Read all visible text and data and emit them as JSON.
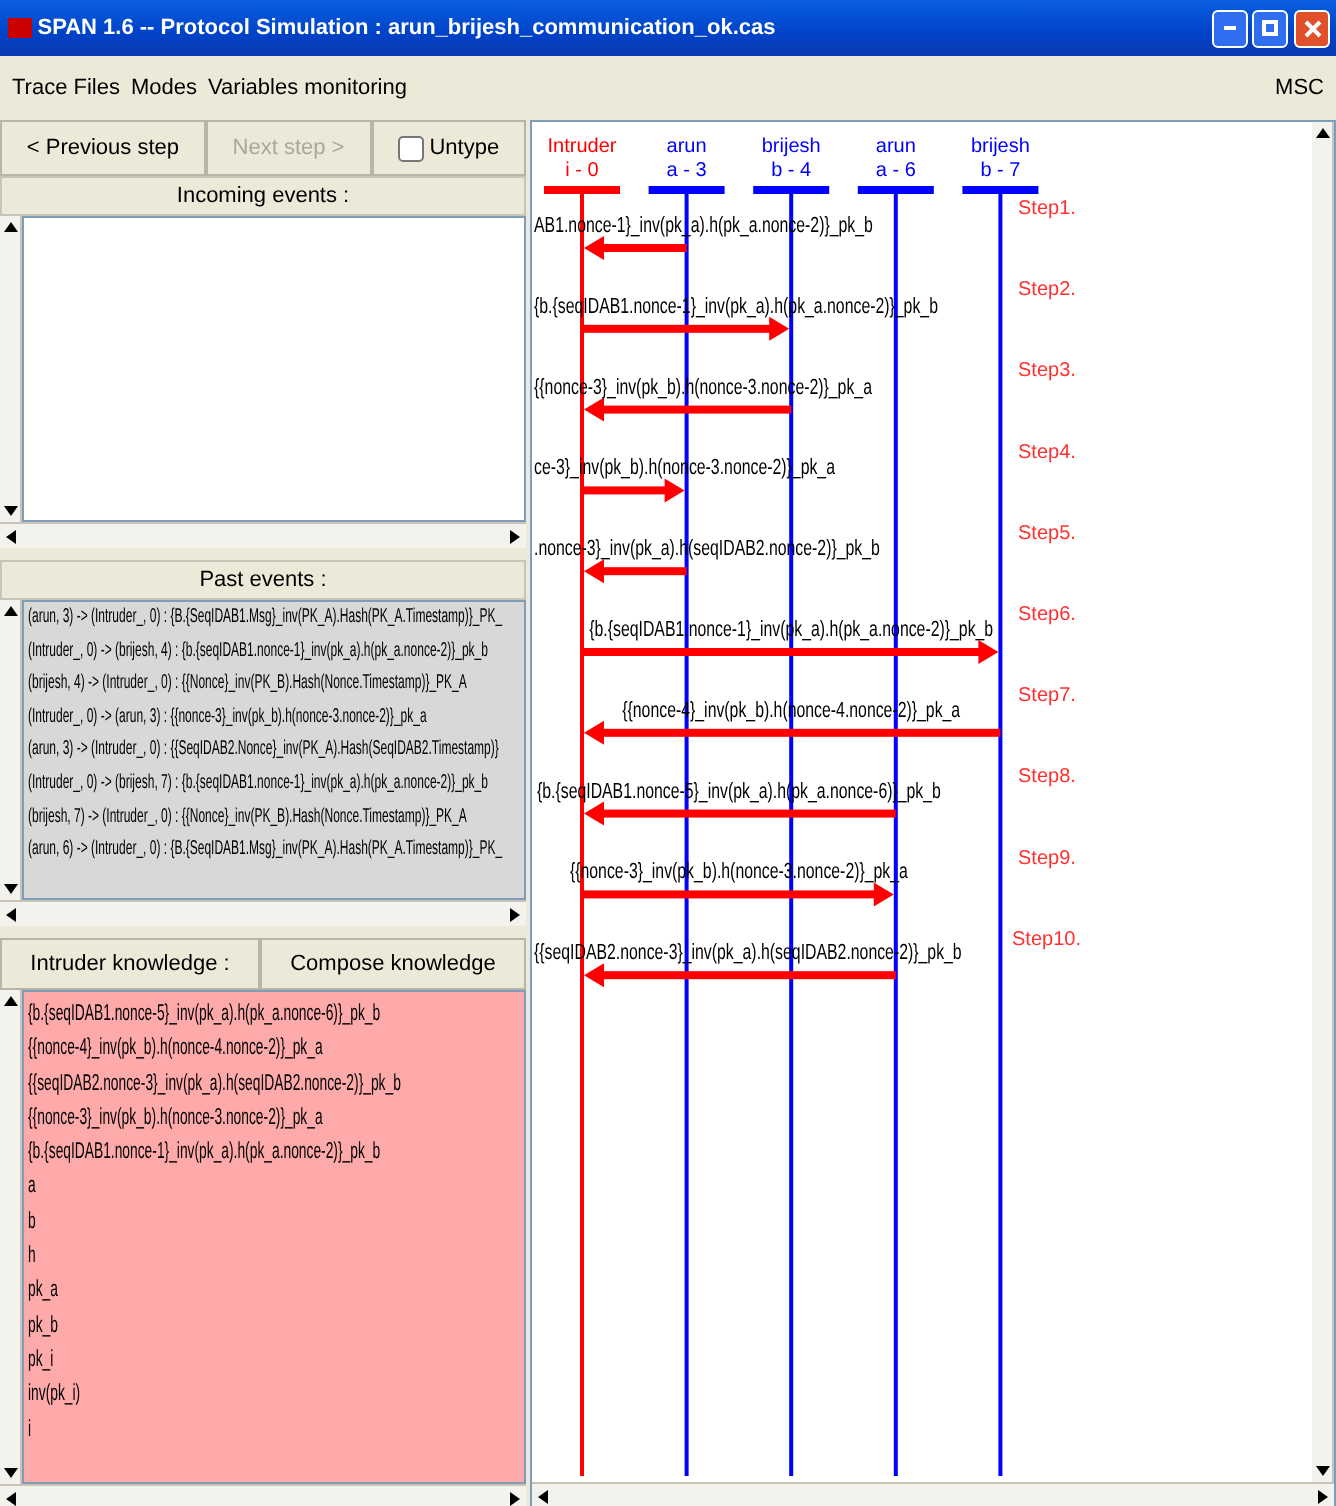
{
  "window": {
    "title": "SPAN 1.6 -- Protocol Simulation : arun_brijesh_communication_ok.cas"
  },
  "menu": [
    "Trace Files",
    "Modes",
    "Variables monitoring"
  ],
  "menu_right": "MSC",
  "controls": {
    "previous": {
      "label": "< Previous step",
      "disabled": false
    },
    "next": {
      "label": "Next step >",
      "disabled": true
    },
    "untype": {
      "label": "Untype",
      "checked": false
    }
  },
  "incoming_events": {
    "title": "Incoming events :"
  },
  "past_events": {
    "title": "Past events :",
    "items": [
      "(arun, 3) -> (Intruder_, 0) : {B.{SeqIDAB1.Msg}_inv(PK_A).Hash(PK_A.Timestamp)}_PK_",
      "(Intruder_, 0) -> (brijesh, 4) : {b.{seqIDAB1.nonce-1}_inv(pk_a).h(pk_a.nonce-2)}_pk_b",
      "(brijesh, 4) -> (Intruder_, 0) : {{Nonce}_inv(PK_B).Hash(Nonce.Timestamp)}_PK_A",
      "(Intruder_, 0) -> (arun, 3) : {{nonce-3}_inv(pk_b).h(nonce-3.nonce-2)}_pk_a",
      "(arun, 3) -> (Intruder_, 0) : {{SeqIDAB2.Nonce}_inv(PK_A).Hash(SeqIDAB2.Timestamp)}",
      "(Intruder_, 0) -> (brijesh, 7) : {b.{seqIDAB1.nonce-1}_inv(pk_a).h(pk_a.nonce-2)}_pk_b",
      "(brijesh, 7) -> (Intruder_, 0) : {{Nonce}_inv(PK_B).Hash(Nonce.Timestamp)}_PK_A",
      "(arun, 6) -> (Intruder_, 0) : {B.{SeqIDAB1.Msg}_inv(PK_A).Hash(PK_A.Timestamp)}_PK_"
    ]
  },
  "knowledge": {
    "tabs": [
      "Intruder knowledge :",
      "Compose knowledge"
    ],
    "items": [
      "{b.{seqIDAB1.nonce-5}_inv(pk_a).h(pk_a.nonce-6)}_pk_b",
      "{{nonce-4}_inv(pk_b).h(nonce-4.nonce-2)}_pk_a",
      "{{seqIDAB2.nonce-3}_inv(pk_a).h(seqIDAB2.nonce-2)}_pk_b",
      "{{nonce-3}_inv(pk_b).h(nonce-3.nonce-2)}_pk_a",
      "{b.{seqIDAB1.nonce-1}_inv(pk_a).h(pk_a.nonce-2)}_pk_b",
      "a",
      "b",
      "h",
      "pk_a",
      "pk_b",
      "pk_i",
      "inv(pk_i)",
      "i"
    ]
  },
  "msc": {
    "participants": [
      {
        "name": "Intruder",
        "id": "i - 0",
        "color": "#ff0000"
      },
      {
        "name": "arun",
        "id": "a - 3",
        "color": "#0000ff"
      },
      {
        "name": "brijesh",
        "id": "b - 4",
        "color": "#0000ff"
      },
      {
        "name": "arun",
        "id": "a - 6",
        "color": "#0000ff"
      },
      {
        "name": "brijesh",
        "id": "b - 7",
        "color": "#0000ff"
      }
    ],
    "steps": [
      "Step1.",
      "Step2.",
      "Step3.",
      "Step4.",
      "Step5.",
      "Step6.",
      "Step7.",
      "Step8.",
      "Step9.",
      "Step10."
    ],
    "messages": [
      {
        "kind": "send-a3",
        "text": "AB1.nonce-1}_inv(pk_a).h(pk_a.nonce-2)}_pk_b"
      },
      {
        "kind": "recv-b4",
        "text": "{b.{seqIDAB1.nonce-1}_inv(pk_a).h(pk_a.nonce-2)}_pk_b"
      },
      {
        "kind": "send-b4",
        "text": "{{nonce-3}_inv(pk_b).h(nonce-3.nonce-2)}_pk_a"
      },
      {
        "kind": "recv-a3",
        "text": "ce-3}_inv(pk_b).h(nonce-3.nonce-2)}_pk_a"
      },
      {
        "kind": "send-a3",
        "text": ".nonce-3}_inv(pk_a).h(seqIDAB2.nonce-2)}_pk_b"
      },
      {
        "kind": "recv-b7",
        "text": "{b.{seqIDAB1.nonce-1}_inv(pk_a).h(pk_a.nonce-2)}_pk_b"
      },
      {
        "kind": "send-b7",
        "text": "{{nonce-4}_inv(pk_b).h(nonce-4.nonce-2)}_pk_a"
      },
      {
        "kind": "send-a6",
        "text": "{b.{seqIDAB1.nonce-5}_inv(pk_a).h(pk_a.nonce-6)}_pk_b"
      },
      {
        "kind": "recv-a6",
        "text": "{{nonce-3}_inv(pk_b).h(nonce-3.nonce-2)}_pk_a"
      },
      {
        "kind": "send-a6",
        "text": "{{seqIDAB2.nonce-3}_inv(pk_a).h(seqIDAB2.nonce-2)}_pk_b"
      }
    ]
  }
}
